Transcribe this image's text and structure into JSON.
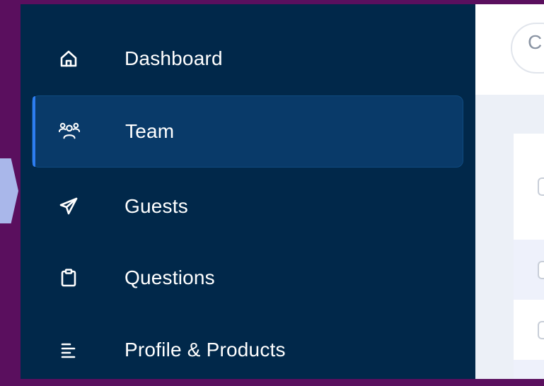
{
  "sidebar": {
    "items": [
      {
        "label": "Dashboard",
        "icon": "home-icon",
        "active": false
      },
      {
        "label": "Team",
        "icon": "team-icon",
        "active": true
      },
      {
        "label": "Guests",
        "icon": "paper-plane-icon",
        "active": false
      },
      {
        "label": "Questions",
        "icon": "clipboard-icon",
        "active": false
      },
      {
        "label": "Profile & Products",
        "icon": "list-icon",
        "active": false
      }
    ]
  },
  "header": {
    "search_partial": "C"
  },
  "colors": {
    "background": "#5a0f5e",
    "sidebar": "#01284a",
    "active_item": "#093a69",
    "accent": "#2d7df0",
    "content": "#ecf0f7"
  }
}
